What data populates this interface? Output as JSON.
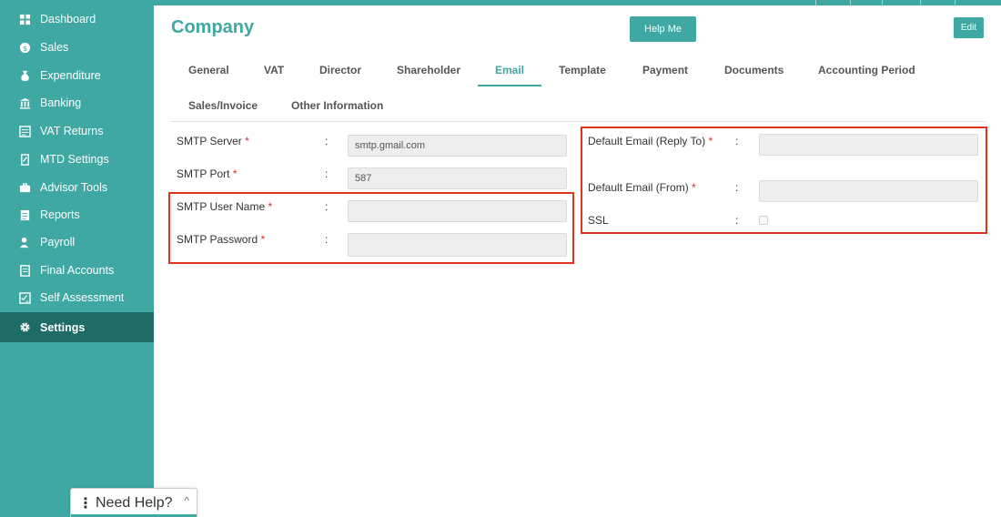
{
  "sidebar": {
    "items": [
      {
        "label": "Dashboard",
        "icon": "dashboard-icon"
      },
      {
        "label": "Sales",
        "icon": "sales-icon"
      },
      {
        "label": "Expenditure",
        "icon": "expenditure-icon"
      },
      {
        "label": "Banking",
        "icon": "bank-icon"
      },
      {
        "label": "VAT Returns",
        "icon": "vat-returns-icon"
      },
      {
        "label": "MTD Settings",
        "icon": "mtd-settings-icon"
      },
      {
        "label": "Advisor Tools",
        "icon": "briefcase-icon"
      },
      {
        "label": "Reports",
        "icon": "reports-icon"
      },
      {
        "label": "Payroll",
        "icon": "payroll-icon"
      },
      {
        "label": "Final Accounts",
        "icon": "final-accounts-icon"
      },
      {
        "label": "Self Assessment",
        "icon": "self-assessment-icon"
      },
      {
        "label": "Settings",
        "icon": "gear-icon"
      }
    ],
    "active": "Settings"
  },
  "header": {
    "title": "Company",
    "help_label": "Help Me",
    "edit_label": "Edit"
  },
  "tabs": {
    "items": [
      "General",
      "VAT",
      "Director",
      "Shareholder",
      "Email",
      "Template",
      "Payment",
      "Documents",
      "Accounting Period",
      "Sales/Invoice",
      "Other Information"
    ],
    "active": "Email"
  },
  "form": {
    "smtp_server": {
      "label": "SMTP Server",
      "value": "smtp.gmail.com"
    },
    "smtp_port": {
      "label": "SMTP Port",
      "value": "587"
    },
    "smtp_user": {
      "label": "SMTP User Name",
      "value": ""
    },
    "smtp_password": {
      "label": "SMTP Password",
      "value": ""
    },
    "default_reply_to": {
      "label": "Default Email (Reply To)",
      "value": ""
    },
    "default_from": {
      "label": "Default Email (From)",
      "value": ""
    },
    "ssl": {
      "label": "SSL",
      "checked": false
    },
    "required_mark": "*",
    "colon": ":"
  },
  "need_help": {
    "dots": "⋮",
    "label": "Need Help?",
    "chevron": "^"
  },
  "colors": {
    "accent": "#3fa8a2",
    "sidebar_active": "#1f6b66",
    "highlight": "#e0331d",
    "required": "#d32f2f"
  }
}
